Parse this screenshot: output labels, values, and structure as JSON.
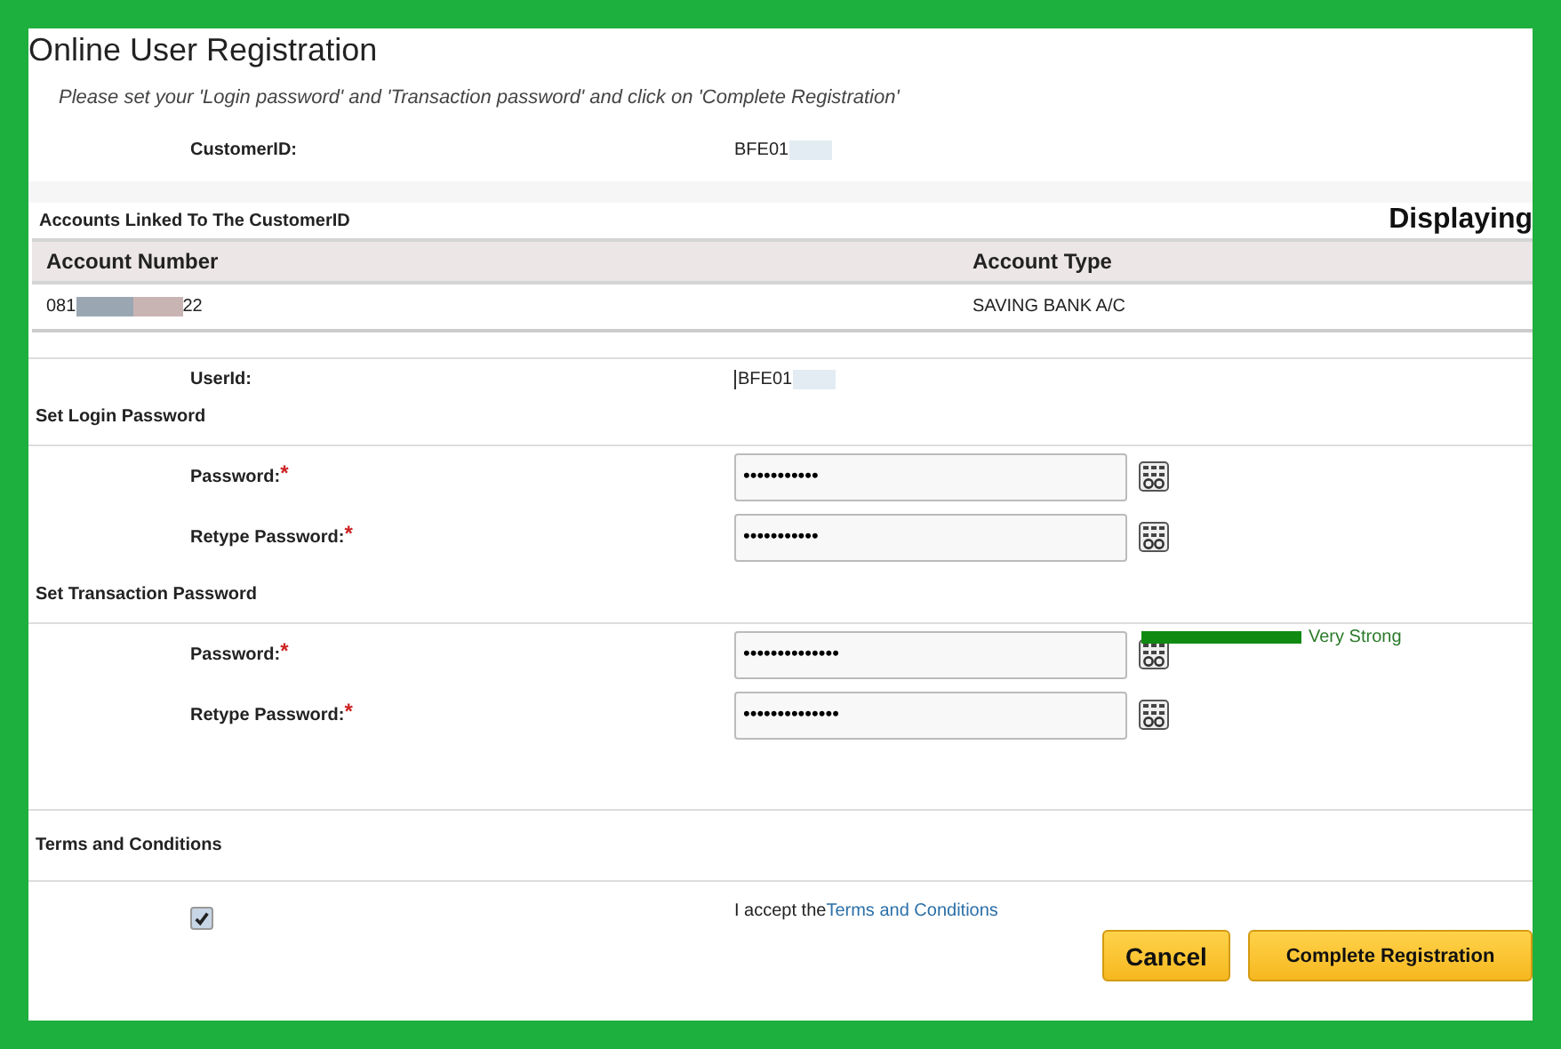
{
  "title": "Online User Registration",
  "instruction": "Please set your 'Login password' and 'Transaction password' and click on 'Complete Registration'",
  "customer": {
    "label": "CustomerID:",
    "value": "BFE01"
  },
  "accounts": {
    "heading": "Accounts Linked To The CustomerID",
    "displaying": "Displaying",
    "columns": [
      "Account Number",
      "Account Type"
    ],
    "rows": [
      {
        "number_start": "081",
        "number_end": "22",
        "type": "SAVING BANK A/C"
      }
    ]
  },
  "user": {
    "label": "UserId:",
    "value": "BFE01"
  },
  "sections": [
    {
      "heading": "Set Login Password",
      "fields": [
        {
          "label": "Password:",
          "required": "*",
          "value": "•••••••••••"
        },
        {
          "label": "Retype Password:",
          "required": "*",
          "value": "•••••••••••"
        }
      ]
    },
    {
      "heading": "Set Transaction Password",
      "strength": {
        "level": 1,
        "label": "Very Strong"
      },
      "fields": [
        {
          "label": "Password:",
          "required": "*",
          "value": "••••••••••••••"
        },
        {
          "label": "Retype Password:",
          "required": "*",
          "value": "••••••••••••••"
        }
      ]
    }
  ],
  "terms": {
    "heading": "Terms and Conditions",
    "checked": true,
    "text": "I accept the",
    "link": "Terms and Conditions"
  },
  "buttons": [
    {
      "kind": "cancel",
      "label": "Cancel"
    },
    {
      "kind": "primary",
      "label": "Complete Registration"
    }
  ]
}
